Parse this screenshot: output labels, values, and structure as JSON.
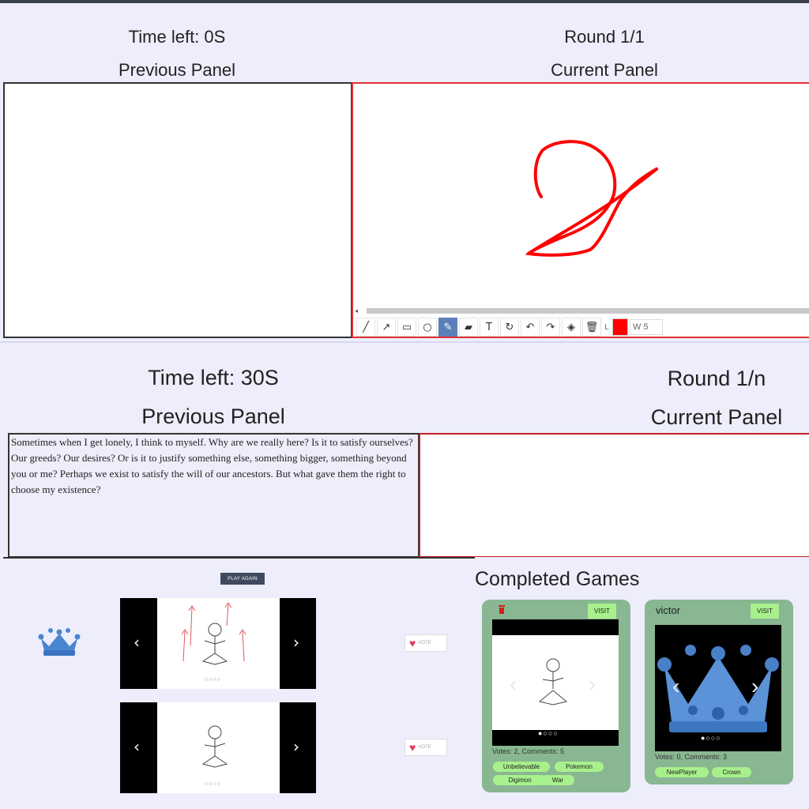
{
  "top_panel": {
    "time_left": "Time left: 0S",
    "round": "Round 1/1",
    "previous_label": "Previous Panel",
    "current_label": "Current Panel",
    "brush_color": "#ff0000",
    "label_l": "L",
    "width_value": "W 5",
    "tools": [
      "line-icon",
      "arrow-icon",
      "rectangle-icon",
      "circle-icon",
      "pen-icon",
      "eraser-icon",
      "text-icon",
      "rotate-icon",
      "undo-icon",
      "redo-icon",
      "fill-icon",
      "trash-icon"
    ]
  },
  "middle_panel": {
    "time_left": "Time left: 30S",
    "round": "Round 1/n",
    "previous_label": "Previous Panel",
    "current_label": "Current Panel",
    "previous_text": "Sometimes when I get lonely, I think to myself. Why are we really here? Is it to satisfy ourselves? Our greeds? Our desires? Or is it to justify something else, something bigger, something beyond you or me? Perhaps we exist to satisfy the will of our ancestors. But what gave them the right to choose my existence?"
  },
  "results": {
    "play_again": "PLAY AGAIN",
    "vote_label": "VOTE",
    "prev_icon": "‹",
    "next_icon": "›",
    "dots": "○○○○"
  },
  "completed": {
    "title": "Completed Games",
    "cards": [
      {
        "owner": "",
        "visit": "VISIT",
        "stats": "Votes: 2, Comments: 5",
        "tags": [
          "Unbelievable",
          "Pokemon",
          "Digimon",
          "War"
        ]
      },
      {
        "owner": "victor",
        "visit": "VISIT",
        "stats": "Votes: 0, Comments: 3",
        "tags": [
          "NewPlayer",
          "Crown"
        ]
      }
    ]
  }
}
